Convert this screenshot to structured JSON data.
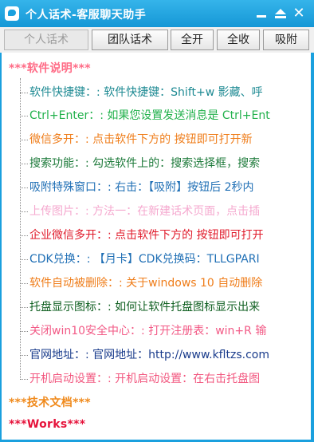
{
  "window": {
    "title": "个人话术-客服聊天助手"
  },
  "toolbar": {
    "personal": "个人话术",
    "team": "团队话术",
    "expand_all": "全开",
    "collapse_all": "全收",
    "attach": "吸附"
  },
  "tree": {
    "category_software": "***软件说明***",
    "category_tech": "***技术文档***",
    "category_works": "***Works***",
    "items": [
      {
        "text": "软件快捷键：: 软件快捷键：Shift+w 影藏、呼",
        "color": "#1e8a93"
      },
      {
        "text": "Ctrl+Enter：: 如果您设置发送消息是 Ctrl+Ent",
        "color": "#22b14c"
      },
      {
        "text": "微信多开：: 点击软件下方的  按钮即可打开新",
        "color": "#ef7d1a"
      },
      {
        "text": "搜索功能：: 勾选软件上的：搜索选择框，搜索",
        "color": "#1d7a3a"
      },
      {
        "text": "吸附特殊窗口：: 右击：【吸附】按钮后  2秒内",
        "color": "#1f6fb5"
      },
      {
        "text": "上传图片：: 方法一：在新建话术页面，点击插",
        "color": "#f5a9cf"
      },
      {
        "text": "企业微信多开：: 点击软件下方的  按钮即可打开",
        "color": "#e01a2a"
      },
      {
        "text": "CDK兑换：: 【月卡】CDK兑换码：TLLGPARI",
        "color": "#1f6fb5"
      },
      {
        "text": "软件自动被删除：: 关于windows 10 自动删除",
        "color": "#ef7d1a"
      },
      {
        "text": "托盘显示图标：: 如何让软件托盘图标显示出来",
        "color": "#0f5f20"
      },
      {
        "text": "关闭win10安全中心：: 打开注册表：win+R 输",
        "color": "#f25a86"
      },
      {
        "text": "官网地址：: 官网地址：http://www.kfltzs.com",
        "color": "#1a3c8c"
      },
      {
        "text": "开机启动设置：: 开机启动设置：在右击托盘图",
        "color": "#f2577f"
      }
    ]
  }
}
